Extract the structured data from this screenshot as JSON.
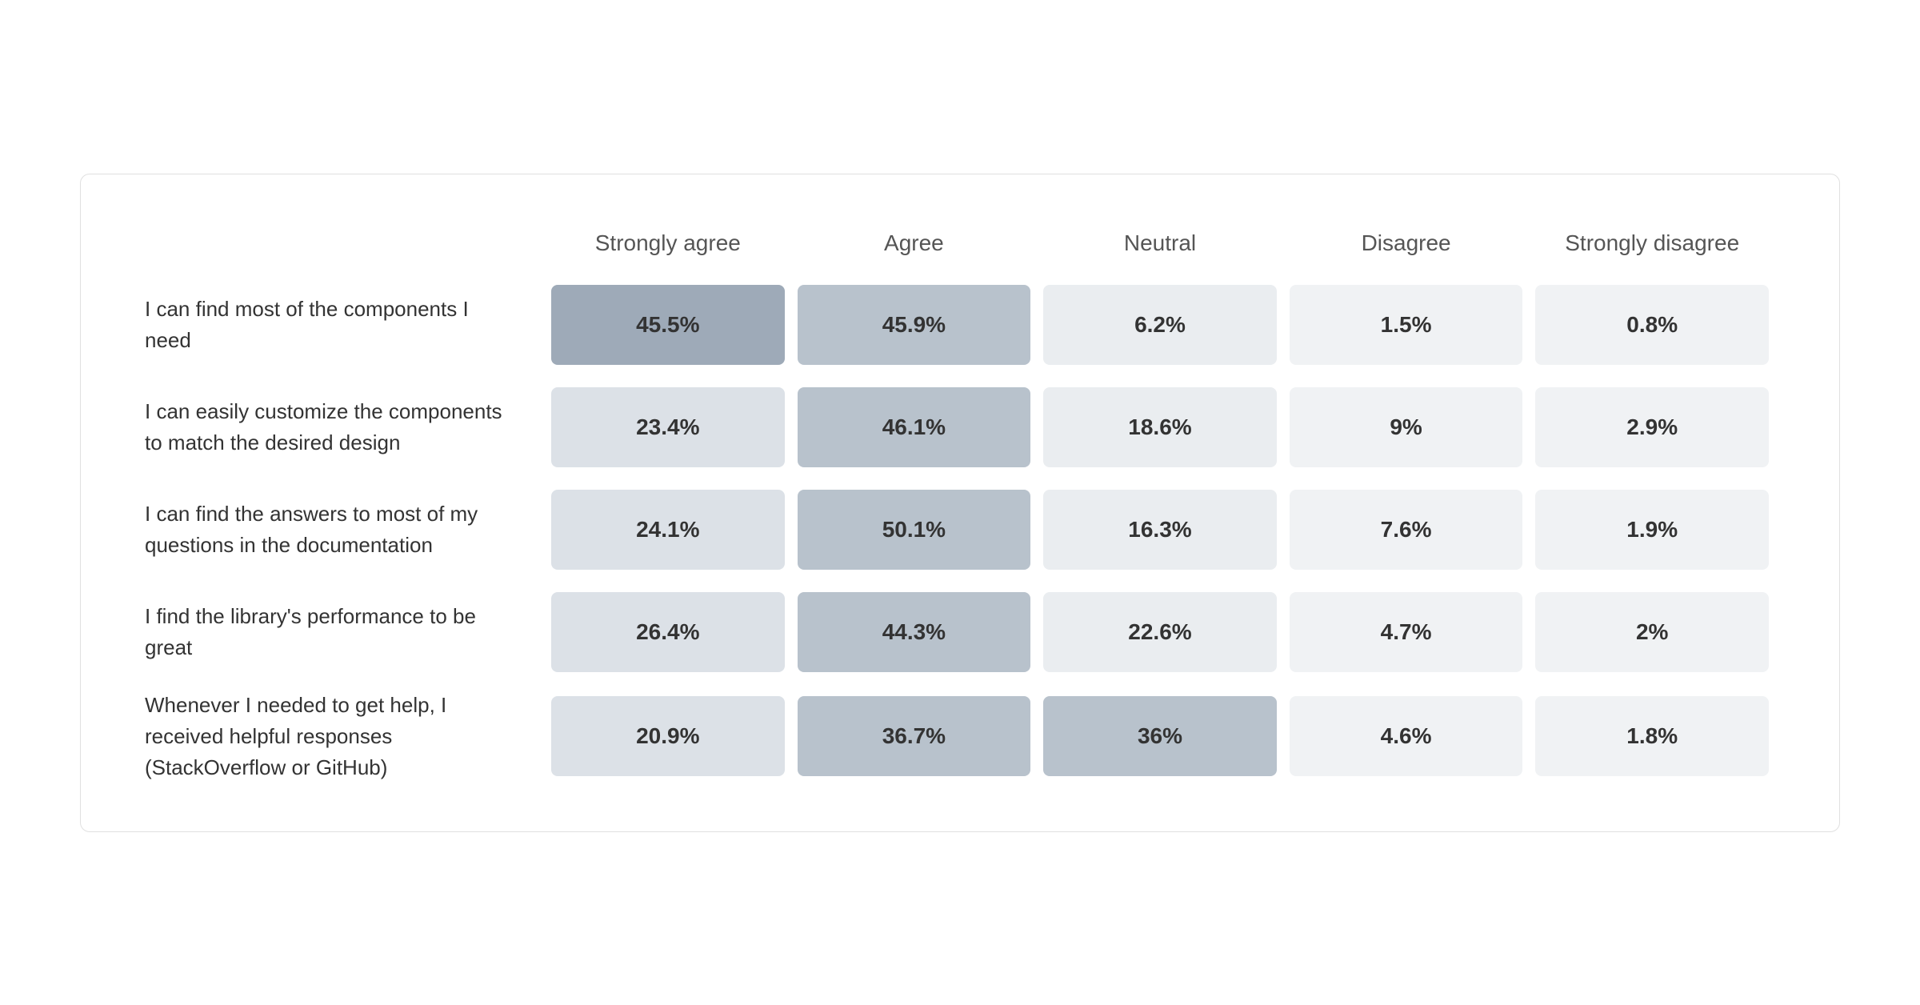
{
  "headers": {
    "empty": "",
    "col1": "Strongly agree",
    "col2": "Agree",
    "col3": "Neutral",
    "col4": "Disagree",
    "col5": "Strongly disagree"
  },
  "rows": [
    {
      "label": "I can find most of the components I need",
      "values": [
        "45.5%",
        "45.9%",
        "6.2%",
        "1.5%",
        "0.8%"
      ],
      "styles": [
        "cell-dark",
        "cell-medium",
        "cell-lighter",
        "cell-lightest",
        "cell-lightest"
      ]
    },
    {
      "label": "I can easily customize the components to match the desired design",
      "values": [
        "23.4%",
        "46.1%",
        "18.6%",
        "9%",
        "2.9%"
      ],
      "styles": [
        "cell-light",
        "cell-medium",
        "cell-lighter",
        "cell-lightest",
        "cell-lightest"
      ]
    },
    {
      "label": "I can find the answers to most of my questions in the documentation",
      "values": [
        "24.1%",
        "50.1%",
        "16.3%",
        "7.6%",
        "1.9%"
      ],
      "styles": [
        "cell-light",
        "cell-medium",
        "cell-lighter",
        "cell-lightest",
        "cell-lightest"
      ]
    },
    {
      "label": "I find the library's performance to be great",
      "values": [
        "26.4%",
        "44.3%",
        "22.6%",
        "4.7%",
        "2%"
      ],
      "styles": [
        "cell-light",
        "cell-medium",
        "cell-lighter",
        "cell-lightest",
        "cell-lightest"
      ]
    },
    {
      "label": "Whenever I needed to get help, I received helpful responses (StackOverflow or GitHub)",
      "values": [
        "20.9%",
        "36.7%",
        "36%",
        "4.6%",
        "1.8%"
      ],
      "styles": [
        "cell-light",
        "cell-medium",
        "cell-medium",
        "cell-lightest",
        "cell-lightest"
      ]
    }
  ]
}
